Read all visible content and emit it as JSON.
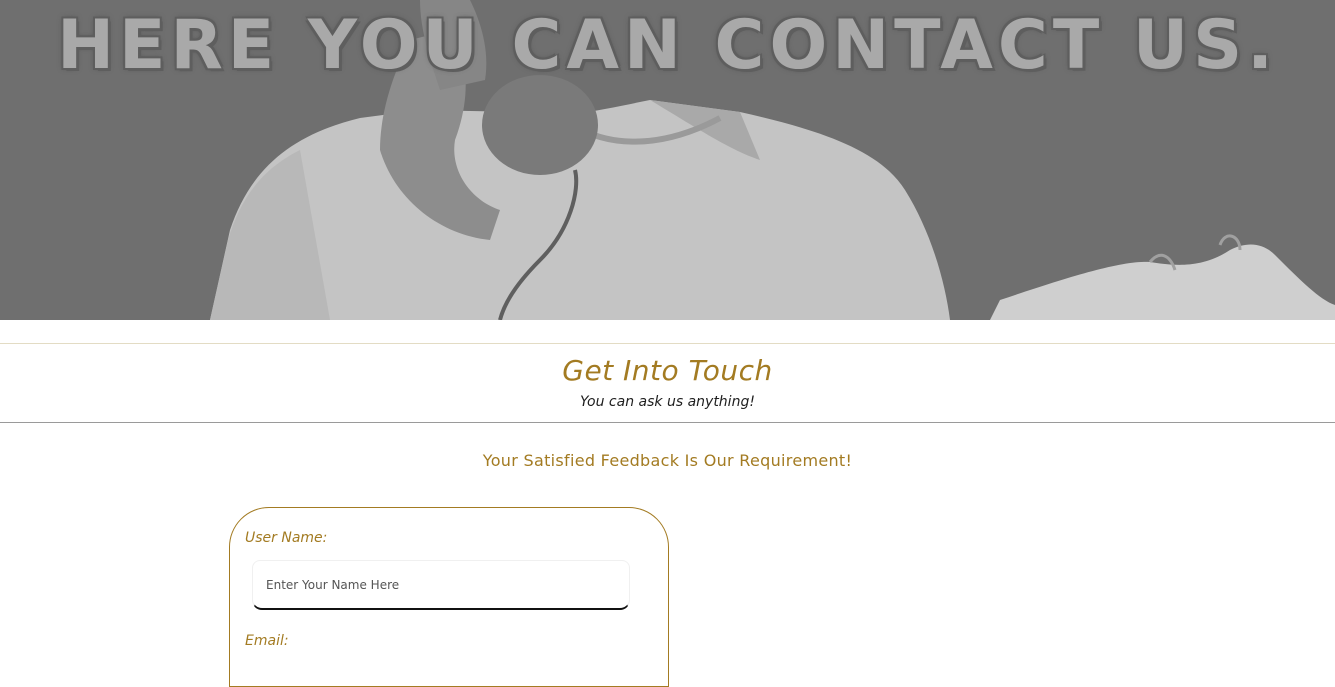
{
  "hero": {
    "title": "HERE YOU CAN CONTACT US."
  },
  "section": {
    "title": "Get Into Touch",
    "subtitle": "You can ask us anything!"
  },
  "feedback": {
    "heading": "Your Satisfied Feedback Is Our Requirement!"
  },
  "form": {
    "username_label": "User Name:",
    "username_placeholder": "Enter Your Name Here",
    "email_label": "Email:"
  },
  "colors": {
    "accent": "#a37b22",
    "hero_overlay": "#6e6e6e"
  }
}
